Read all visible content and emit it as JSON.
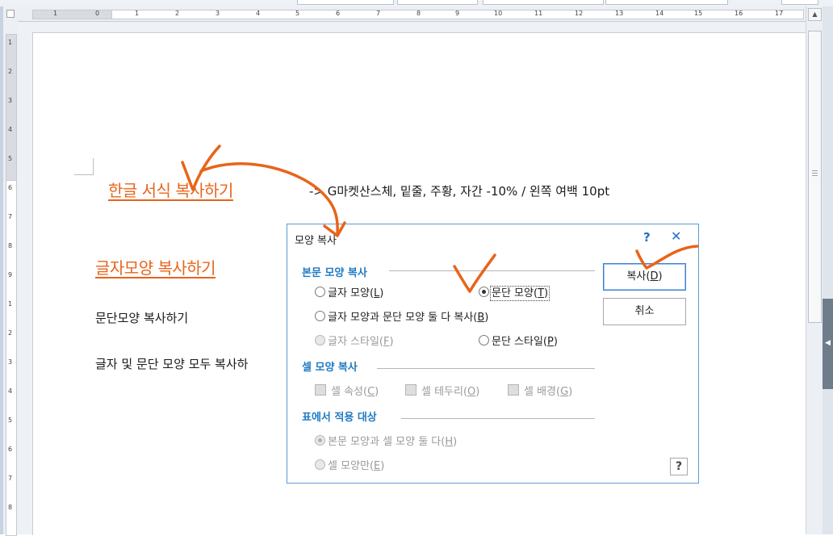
{
  "document": {
    "heading1": "한글 서식 복사하기",
    "heading1_note": "->  G마켓산스체, 밑줄, 주황, 자간 -10%   /    왼쪽 여백 10pt",
    "heading2": "글자모양 복사하기",
    "line1": "문단모양 복사하기",
    "line2": "글자 및 문단 모양 모두 복사하"
  },
  "ruler": {
    "h_numbers": [
      "1",
      "0",
      "1",
      "2",
      "3",
      "4",
      "5",
      "6",
      "7",
      "8",
      "9",
      "10",
      "11",
      "12",
      "13",
      "14",
      "15",
      "16",
      "17"
    ],
    "v_numbers": [
      "1",
      "2",
      "3",
      "4",
      "5",
      "6",
      "7",
      "8",
      "9",
      "1",
      "2",
      "3",
      "4",
      "5",
      "6",
      "7",
      "8"
    ]
  },
  "dialog": {
    "title": "모양 복사",
    "help_icon": "?",
    "close_icon": "✕",
    "section_body": "본문 모양 복사",
    "opt_char": {
      "pre": "글자 모양(",
      "key": "L",
      "post": ")"
    },
    "opt_para": {
      "pre": "문단 모양(",
      "key": "T",
      "post": ")"
    },
    "opt_both": {
      "pre": "글자 모양과 문단 모양 둘 다 복사(",
      "key": "B",
      "post": ")"
    },
    "opt_char_style": {
      "pre": "글자 스타일(",
      "key": "F",
      "post": ")"
    },
    "opt_para_style": {
      "pre": "문단 스타일(",
      "key": "P",
      "post": ")"
    },
    "section_cell": "셀 모양 복사",
    "chk_cell_attr": {
      "pre": "셀 속성(",
      "key": "C",
      "post": ")"
    },
    "chk_cell_border": {
      "pre": "셀 테두리(",
      "key": "O",
      "post": ")"
    },
    "chk_cell_bg": {
      "pre": "셀 배경(",
      "key": "G",
      "post": ")"
    },
    "section_table": "표에서 적용 대상",
    "opt_body_and_cell": {
      "pre": "본문 모양과 셀 모양 둘 다(",
      "key": "H",
      "post": ")"
    },
    "opt_cell_only": {
      "pre": "셀 모양만(",
      "key": "E",
      "post": ")"
    },
    "copy_button": {
      "pre": "복사(",
      "key": "D",
      "post": ")"
    },
    "cancel_button": "취소",
    "help_button": "?",
    "selected_option": "문단 모양"
  },
  "colors": {
    "heading": "#e8641a",
    "annotation": "#e8641a",
    "dialog_border": "#5b9bd5",
    "section_text": "#1f7ac2"
  },
  "icons": {
    "help": "question-mark-icon",
    "close": "close-icon",
    "page_tab": "chevron-left-icon"
  }
}
